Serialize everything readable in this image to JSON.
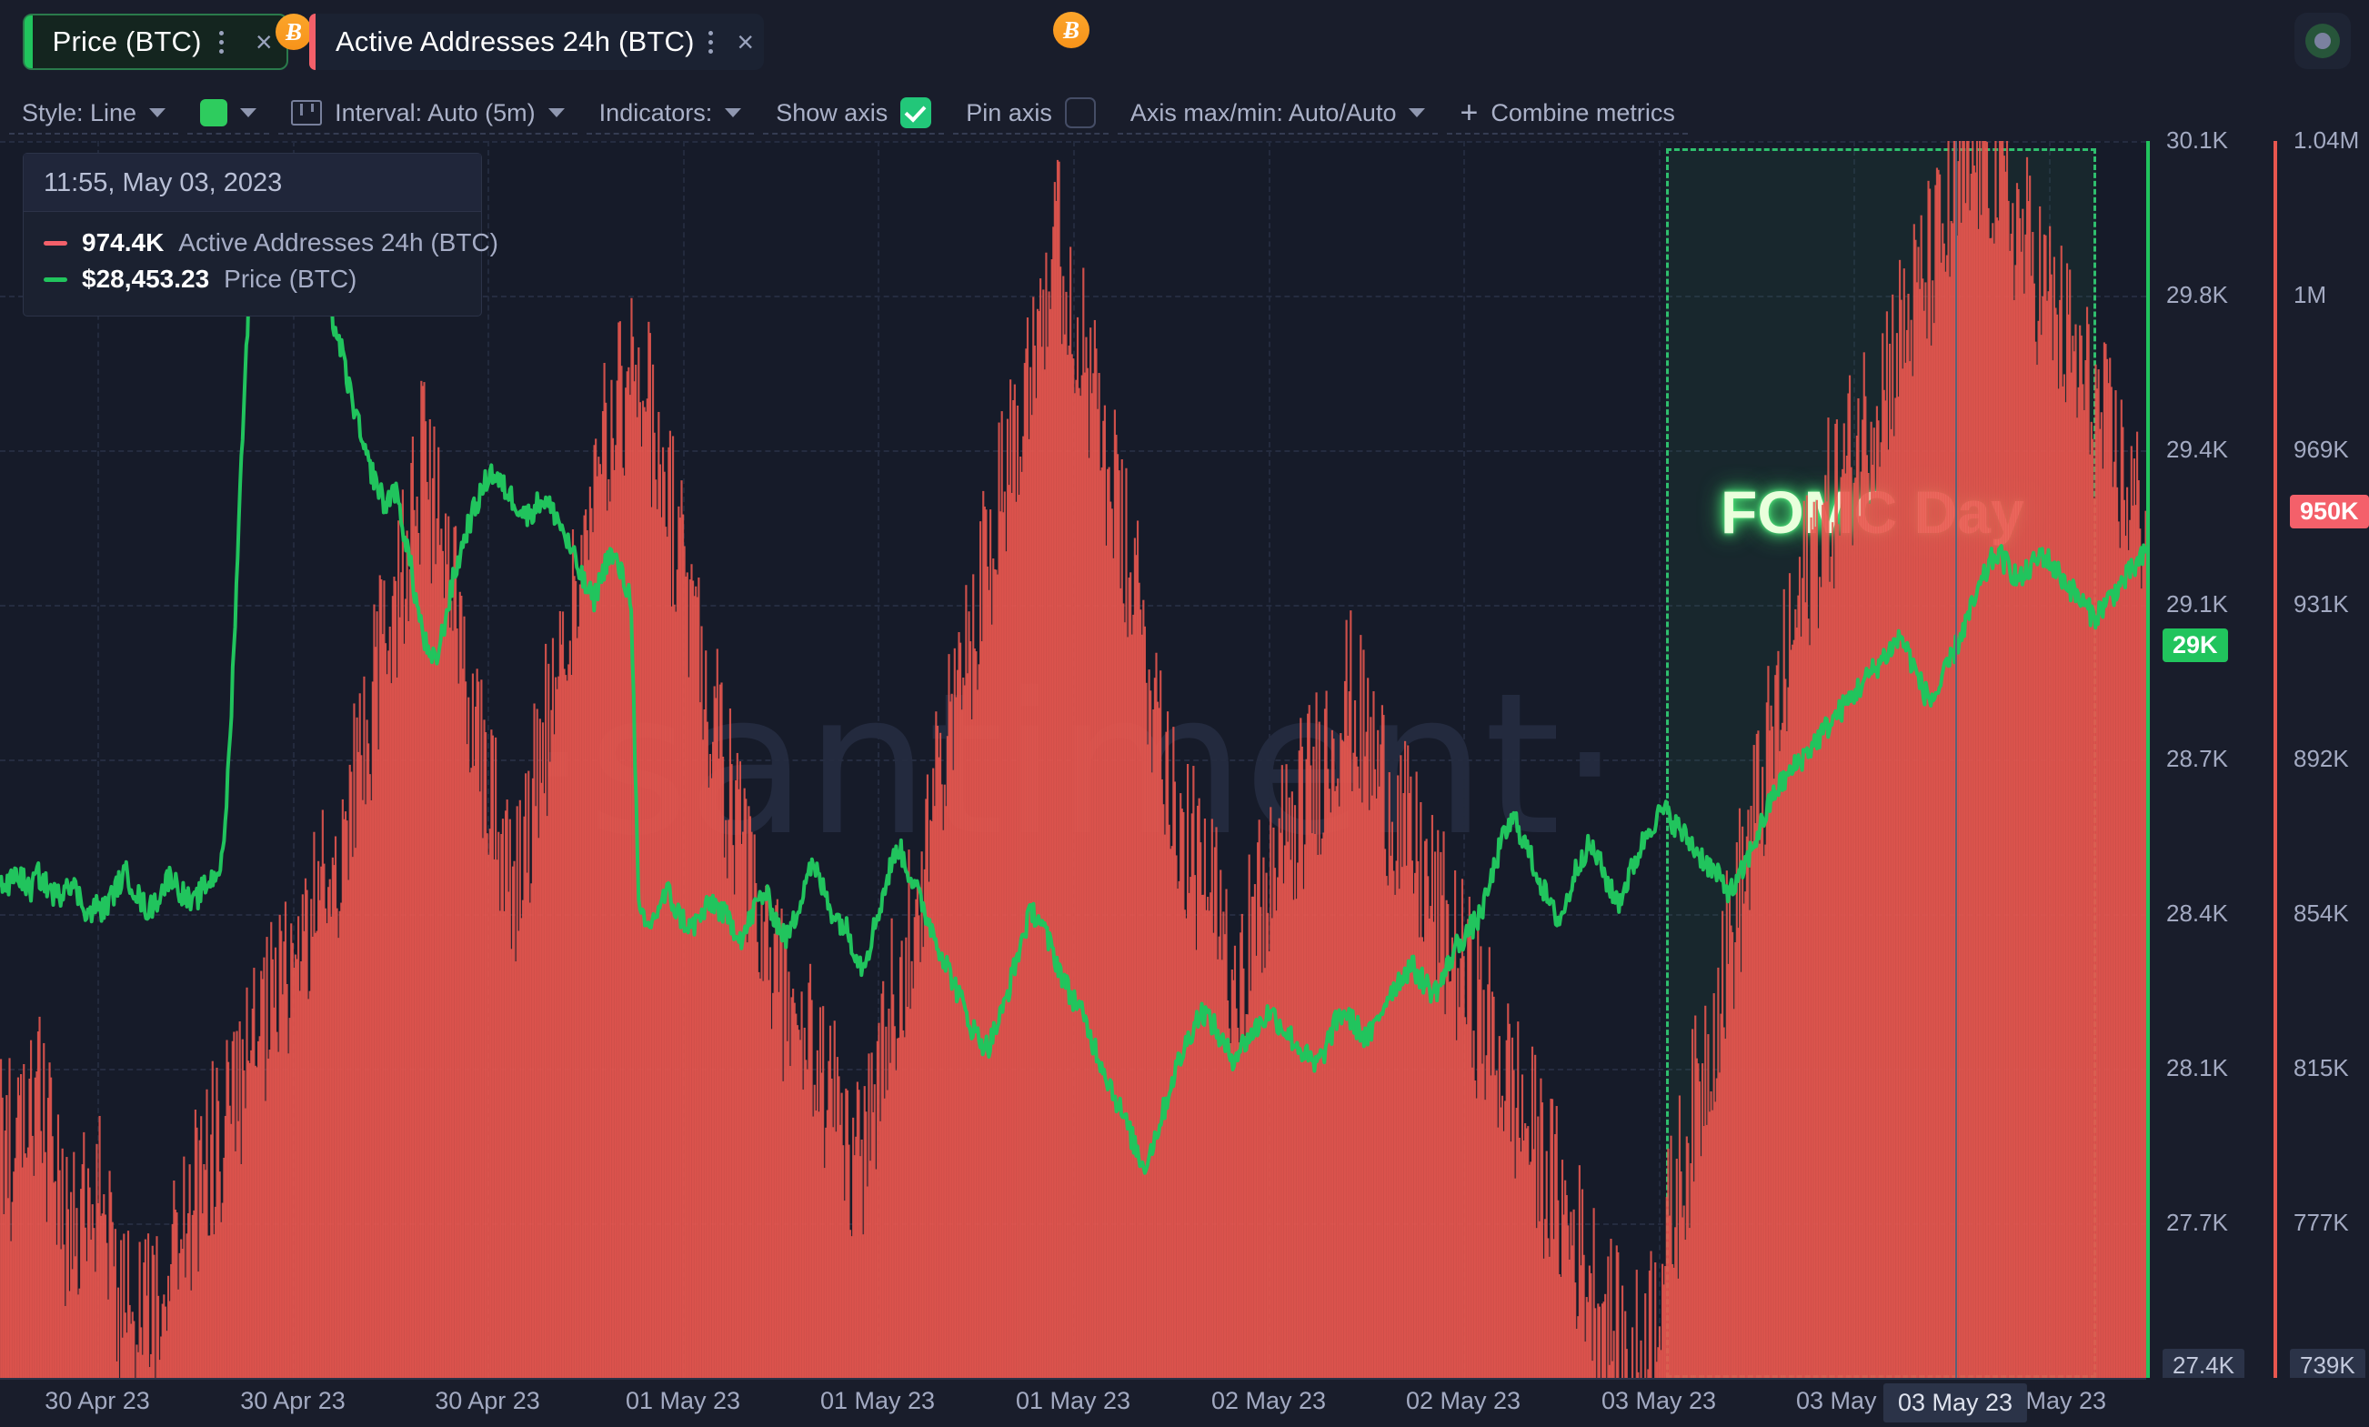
{
  "app": {
    "background": "#191d2b",
    "plot_background": "#161b29"
  },
  "tabs": [
    {
      "label": "Price (BTC)",
      "accent": "#21c45d",
      "active": true,
      "badge": "Ƀ",
      "menu_icon": "kebab-menu-icon",
      "close_icon": "×"
    },
    {
      "label": "Active Addresses 24h (BTC)",
      "accent": "#f4606a",
      "active": false,
      "badge": "Ƀ",
      "menu_icon": "kebab-menu-icon",
      "close_icon": "×"
    }
  ],
  "record_button": {
    "name": "record-indicator",
    "outer_color": "#27553a",
    "inner_color": "#7b81a0"
  },
  "toolbar": {
    "style_label": "Style: Line",
    "color_swatch": "#2ecc5e",
    "interval_label": "Interval: Auto (5m)",
    "indicators_label": "Indicators:",
    "show_axis_label": "Show axis",
    "show_axis_checked": true,
    "pin_axis_label": "Pin axis",
    "pin_axis_checked": false,
    "axis_minmax_label": "Axis max/min: Auto/Auto",
    "combine_label": "Combine metrics",
    "combine_plus": "+"
  },
  "tooltip": {
    "timestamp": "11:55, May 03, 2023",
    "rows": [
      {
        "value": "974.4K",
        "name": "Active Addresses 24h (BTC)",
        "color": "#f4606a"
      },
      {
        "value": "$28,453.23",
        "name": "Price (BTC)",
        "color": "#21c45d"
      }
    ]
  },
  "annotation": {
    "label": "FOMC Day",
    "text_color": "#e9ffdc",
    "glow_color": "#4ef07d",
    "border_color": "#2fbf6e"
  },
  "watermark": {
    "text": "·santiment·",
    "color": "#232a3e"
  },
  "crosshair": {
    "x_label": "03 May 23"
  },
  "chart_data": {
    "type": "line",
    "title": "Price (BTC) vs Active Addresses 24h (BTC)",
    "xlabel": "",
    "ylabel_left": "Price (BTC)",
    "ylabel_right": "Active Addresses 24h (BTC)",
    "grid": true,
    "legend_position": "tooltip-top-left",
    "x_ticks": [
      "30 Apr 23",
      "30 Apr 23",
      "30 Apr 23",
      "01 May 23",
      "01 May 23",
      "01 May 23",
      "02 May 23",
      "02 May 23",
      "03 May 23",
      "03 May 23",
      "03 May 23"
    ],
    "left_axis": {
      "name": "Price (BTC)",
      "color": "#21c45d",
      "ticks": [
        "30.1K",
        "29.8K",
        "29.4K",
        "29.1K",
        "28.7K",
        "28.4K",
        "28.1K",
        "27.7K",
        "27.4K"
      ],
      "ylim": [
        27400,
        30100
      ],
      "last_value_badge": "29K",
      "min_badge": "27.4K"
    },
    "right_axis": {
      "name": "Active Addresses 24h (BTC)",
      "color": "#f4606a",
      "ticks": [
        "1.04M",
        "1M",
        "969K",
        "931K",
        "892K",
        "854K",
        "815K",
        "777K",
        "739K"
      ],
      "ylim": [
        739000,
        1040000
      ],
      "last_value_badge": "950K",
      "min_badge": "739K"
    },
    "series": [
      {
        "name": "Price (BTC)",
        "type": "line",
        "color": "#21c45d",
        "axis": "left",
        "values": [
          28480,
          28470,
          28500,
          28490,
          28460,
          28500,
          28480,
          28460,
          28450,
          28490,
          28470,
          28440,
          28410,
          28430,
          28420,
          28450,
          28480,
          28500,
          28470,
          28440,
          28420,
          28440,
          28470,
          28500,
          28470,
          28450,
          28430,
          28460,
          28480,
          28500,
          28530,
          28800,
          29200,
          29600,
          29900,
          30050,
          29980,
          29900,
          30020,
          29950,
          29880,
          29940,
          29850,
          29800,
          29760,
          29700,
          29640,
          29560,
          29500,
          29420,
          29380,
          29340,
          29300,
          29350,
          29280,
          29200,
          29100,
          29020,
          28960,
          28980,
          29060,
          29140,
          29200,
          29260,
          29300,
          29340,
          29380,
          29360,
          29340,
          29320,
          29300,
          29280,
          29300,
          29320,
          29300,
          29280,
          29240,
          29200,
          29160,
          29120,
          29100,
          29150,
          29200,
          29180,
          29140,
          29100,
          28420,
          28380,
          28400,
          28440,
          28460,
          28420,
          28400,
          28380,
          28400,
          28420,
          28440,
          28420,
          28400,
          28380,
          28360,
          28400,
          28440,
          28460,
          28420,
          28380,
          28360,
          28400,
          28460,
          28520,
          28500,
          28460,
          28420,
          28400,
          28380,
          28340,
          28300,
          28340,
          28400,
          28460,
          28520,
          28560,
          28520,
          28480,
          28440,
          28400,
          28360,
          28320,
          28280,
          28240,
          28200,
          28160,
          28140,
          28120,
          28160,
          28200,
          28260,
          28320,
          28380,
          28420,
          28400,
          28360,
          28320,
          28280,
          28240,
          28220,
          28180,
          28140,
          28100,
          28060,
          28020,
          27980,
          27940,
          27900,
          27860,
          27900,
          27950,
          28000,
          28060,
          28100,
          28140,
          28180,
          28200,
          28180,
          28150,
          28120,
          28100,
          28120,
          28140,
          28160,
          28180,
          28200,
          28180,
          28160,
          28140,
          28120,
          28100,
          28080,
          28100,
          28140,
          28180,
          28200,
          28180,
          28160,
          28140,
          28160,
          28200,
          28240,
          28260,
          28280,
          28300,
          28280,
          28260,
          28240,
          28260,
          28300,
          28340,
          28360,
          28380,
          28400,
          28440,
          28500,
          28560,
          28600,
          28620,
          28580,
          28540,
          28500,
          28460,
          28420,
          28400,
          28440,
          28500,
          28540,
          28560,
          28540,
          28500,
          28460,
          28440,
          28480,
          28520,
          28560,
          28600,
          28620,
          28640,
          28620,
          28600,
          28580,
          28560,
          28540,
          28520,
          28500,
          28480,
          28460,
          28480,
          28520,
          28560,
          28600,
          28640,
          28680,
          28700,
          28720,
          28740,
          28760,
          28780,
          28800,
          28820,
          28840,
          28860,
          28880,
          28900,
          28920,
          28940,
          28960,
          28980,
          29000,
          29020,
          28980,
          28940,
          28900,
          28880,
          28900,
          28940,
          28980,
          29020,
          29060,
          29100,
          29140,
          29180,
          29200,
          29180,
          29160,
          29140,
          29160,
          29180,
          29200,
          29180,
          29160,
          29140,
          29120,
          29100,
          29080,
          29060,
          29080,
          29100,
          29120,
          29140,
          29160,
          29180,
          29200
        ]
      },
      {
        "name": "Active Addresses 24h (BTC)",
        "type": "area",
        "color": "#e8564f",
        "axis": "right",
        "values": [
          800000,
          795000,
          790000,
          800000,
          810000,
          800000,
          790000,
          780000,
          770000,
          780000,
          790000,
          785000,
          775000,
          765000,
          760000,
          755000,
          750000,
          755000,
          760000,
          765000,
          770000,
          775000,
          780000,
          785000,
          790000,
          795000,
          800000,
          805000,
          810000,
          815000,
          820000,
          825000,
          830000,
          835000,
          840000,
          845000,
          850000,
          855000,
          860000,
          865000,
          870000,
          880000,
          890000,
          900000,
          910000,
          920000,
          930000,
          940000,
          950000,
          960000,
          955000,
          945000,
          935000,
          925000,
          915000,
          905000,
          895000,
          885000,
          875000,
          865000,
          860000,
          870000,
          880000,
          890000,
          900000,
          910000,
          920000,
          930000,
          940000,
          950000,
          960000,
          970000,
          975000,
          980000,
          985000,
          980000,
          970000,
          960000,
          950000,
          940000,
          930000,
          920000,
          910000,
          900000,
          890000,
          880000,
          870000,
          860000,
          850000,
          845000,
          840000,
          835000,
          830000,
          825000,
          820000,
          815000,
          810000,
          805000,
          800000,
          795000,
          790000,
          800000,
          810000,
          820000,
          830000,
          840000,
          850000,
          860000,
          870000,
          880000,
          890000,
          900000,
          910000,
          920000,
          930000,
          940000,
          950000,
          960000,
          970000,
          980000,
          990000,
          1000000,
          1010000,
          1015000,
          1010000,
          1000000,
          990000,
          980000,
          970000,
          960000,
          950000,
          940000,
          930000,
          920000,
          910000,
          900000,
          890000,
          880000,
          870000,
          865000,
          860000,
          855000,
          850000,
          845000,
          840000,
          845000,
          850000,
          855000,
          860000,
          865000,
          870000,
          875000,
          880000,
          885000,
          890000,
          895000,
          900000,
          905000,
          900000,
          895000,
          890000,
          885000,
          880000,
          875000,
          870000,
          865000,
          860000,
          855000,
          850000,
          845000,
          840000,
          835000,
          830000,
          825000,
          820000,
          815000,
          810000,
          805000,
          800000,
          795000,
          790000,
          785000,
          780000,
          775000,
          770000,
          765000,
          760000,
          755000,
          750000,
          745000,
          742000,
          745000,
          750000,
          760000,
          770000,
          780000,
          790000,
          800000,
          810000,
          820000,
          830000,
          840000,
          850000,
          860000,
          870000,
          880000,
          890000,
          900000,
          910000,
          920000,
          930000,
          940000,
          945000,
          950000,
          955000,
          960000,
          965000,
          970000,
          975000,
          980000,
          985000,
          990000,
          995000,
          1000000,
          1005000,
          1010000,
          1015000,
          1020000,
          1025000,
          1030000,
          1035000,
          1038000,
          1035000,
          1030000,
          1025000,
          1020000,
          1015000,
          1010000,
          1005000,
          1000000,
          995000,
          990000,
          985000,
          980000,
          975000,
          970000,
          965000,
          960000,
          955000,
          950000,
          950000
        ]
      }
    ],
    "annotations": [
      {
        "type": "region",
        "label": "FOMC Day",
        "start": "03 May 23",
        "end": "03 May 23",
        "color": "#2fbf6e"
      },
      {
        "type": "crosshair",
        "label": "03 May 23",
        "timestamp": "11:55, May 03, 2023"
      }
    ]
  }
}
